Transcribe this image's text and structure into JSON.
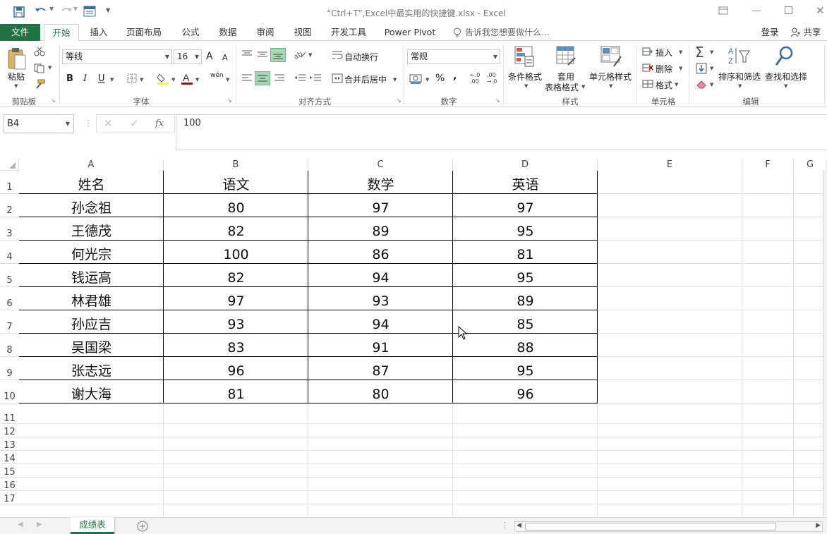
{
  "window": {
    "title": "“Ctrl+T”,Excel中最实用的快捷键.xlsx - Excel"
  },
  "tabs": [
    {
      "label": "文件"
    },
    {
      "label": "开始"
    },
    {
      "label": "插入"
    },
    {
      "label": "页面布局"
    },
    {
      "label": "公式"
    },
    {
      "label": "数据"
    },
    {
      "label": "审阅"
    },
    {
      "label": "视图"
    },
    {
      "label": "开发工具"
    },
    {
      "label": "Power Pivot"
    }
  ],
  "tell_me": "告诉我您想要做什么...",
  "account": {
    "login": "登录",
    "share": "共享"
  },
  "ribbon": {
    "clipboard": {
      "paste": "粘贴",
      "group": "剪贴板"
    },
    "font": {
      "name": "等线",
      "size": "16",
      "bold": "B",
      "italic": "I",
      "underline": "U",
      "group": "字体",
      "grow": "A",
      "shrink": "A",
      "wen": "wén"
    },
    "alignment": {
      "wrap": "自动换行",
      "merge": "合并后居中",
      "group": "对齐方式"
    },
    "number": {
      "format": "常规",
      "percent": "%",
      "comma": ",",
      "inc_dec": ".0\n.00",
      "dec_dec": ".00\n.0",
      "group": "数字"
    },
    "styles": {
      "conditional": "条件格式",
      "table_line1": "套用",
      "table_line2": "表格格式",
      "cell_styles": "单元格样式",
      "group": "样式"
    },
    "cells": {
      "insert": "插入",
      "delete": "删除",
      "format": "格式",
      "group": "单元格"
    },
    "editing": {
      "sort": "排序和筛选",
      "find": "查找和选择",
      "group": "编辑"
    }
  },
  "formula": {
    "namebox": "B4",
    "fx": "fx",
    "value": "100"
  },
  "sheet": {
    "columns": [
      "A",
      "B",
      "C",
      "D",
      "E",
      "F",
      "G"
    ],
    "row_numbers": [
      "1",
      "2",
      "3",
      "4",
      "5",
      "6",
      "7",
      "8",
      "9",
      "10",
      "11",
      "12",
      "13",
      "14",
      "15",
      "16",
      "17"
    ],
    "header": [
      "姓名",
      "语文",
      "数学",
      "英语"
    ],
    "rows": [
      [
        "孙念祖",
        "80",
        "97",
        "97"
      ],
      [
        "王德茂",
        "82",
        "89",
        "95"
      ],
      [
        "何光宗",
        "100",
        "86",
        "81"
      ],
      [
        "钱运高",
        "82",
        "94",
        "95"
      ],
      [
        "林君雄",
        "97",
        "93",
        "89"
      ],
      [
        "孙应吉",
        "93",
        "94",
        "85"
      ],
      [
        "吴国梁",
        "83",
        "91",
        "88"
      ],
      [
        "张志远",
        "96",
        "87",
        "95"
      ],
      [
        "谢大海",
        "81",
        "80",
        "96"
      ]
    ]
  },
  "sheet_tabs": [
    {
      "label": "成绩表"
    }
  ],
  "colors": {
    "excel_green": "#217346",
    "active_tab_text": "#217346",
    "border": "#000000"
  }
}
